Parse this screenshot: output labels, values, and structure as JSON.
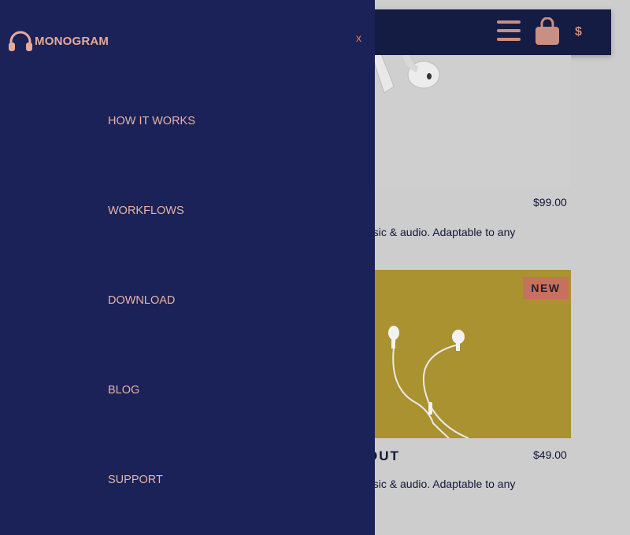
{
  "drawer": {
    "logo_text": "MONOGRAM",
    "close_label": "x",
    "nav": [
      {
        "label": "HOW IT WORKS"
      },
      {
        "label": "WORKFLOWS"
      },
      {
        "label": "DOWNLOAD"
      },
      {
        "label": "BLOG"
      },
      {
        "label": "SUPPORT"
      }
    ]
  },
  "header": {
    "currency": "$"
  },
  "products": [
    {
      "price": "$99.00",
      "desc": "usic & audio. Adaptable to any"
    },
    {
      "title": "OUT",
      "badge": "NEW",
      "price": "$49.00",
      "desc": "usic & audio. Adaptable to any"
    }
  ],
  "colors": {
    "drawer_bg": "#1a2257",
    "accent": "#e7a99b",
    "header_bg": "#141c44",
    "badge_bg": "#c7705d"
  }
}
